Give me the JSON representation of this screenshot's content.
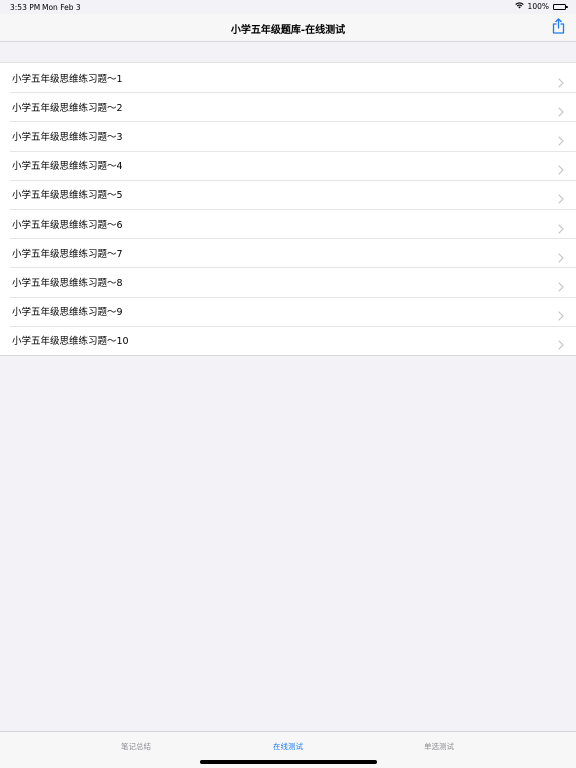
{
  "status_bar": {
    "time": "3:53 PM",
    "date": "Mon Feb 3",
    "battery_text": "100%",
    "battery_level": 1.0
  },
  "nav": {
    "title": "小学五年级题库-在线测试",
    "share_icon": "share-icon",
    "accent_color": "#1c7cf4"
  },
  "list": {
    "items": [
      {
        "label": "小学五年级思维练习题～1"
      },
      {
        "label": "小学五年级思维练习题～2"
      },
      {
        "label": "小学五年级思维练习题～3"
      },
      {
        "label": "小学五年级思维练习题～4"
      },
      {
        "label": "小学五年级思维练习题～5"
      },
      {
        "label": "小学五年级思维练习题～6"
      },
      {
        "label": "小学五年级思维练习题～7"
      },
      {
        "label": "小学五年级思维练习题～8"
      },
      {
        "label": "小学五年级思维练习题～9"
      },
      {
        "label": "小学五年级思维练习题～10"
      }
    ],
    "chevron_icon": "chevron-right-icon"
  },
  "tab_bar": {
    "tabs": [
      {
        "label": "笔记总结",
        "active": false
      },
      {
        "label": "在线测试",
        "active": true
      },
      {
        "label": "单选测试",
        "active": false
      }
    ]
  }
}
